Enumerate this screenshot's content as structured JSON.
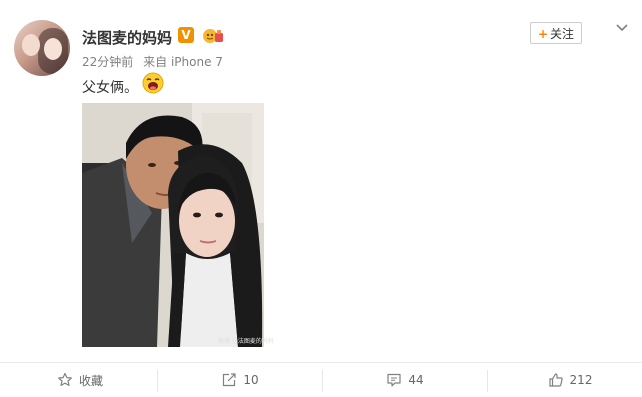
{
  "post": {
    "author": "法图麦的妈妈",
    "verified_badge": "V",
    "time": "22分钟前",
    "source_prefix": "来自",
    "source": "iPhone 7",
    "text": "父女俩。",
    "follow_label": "关注",
    "follow_plus": "+",
    "watermark": "微博 @法图麦的妈妈"
  },
  "actions": {
    "favorite_label": "收藏",
    "repost_count": "10",
    "comment_count": "44",
    "like_count": "212"
  },
  "colors": {
    "accent": "#ff8200",
    "verified": "#f29100",
    "text": "#333333",
    "muted": "#808080"
  },
  "icons": [
    "chevron-down-icon",
    "star-icon",
    "share-icon",
    "comment-icon",
    "like-icon",
    "laughing-emoji-icon",
    "vip-badge-icon"
  ]
}
